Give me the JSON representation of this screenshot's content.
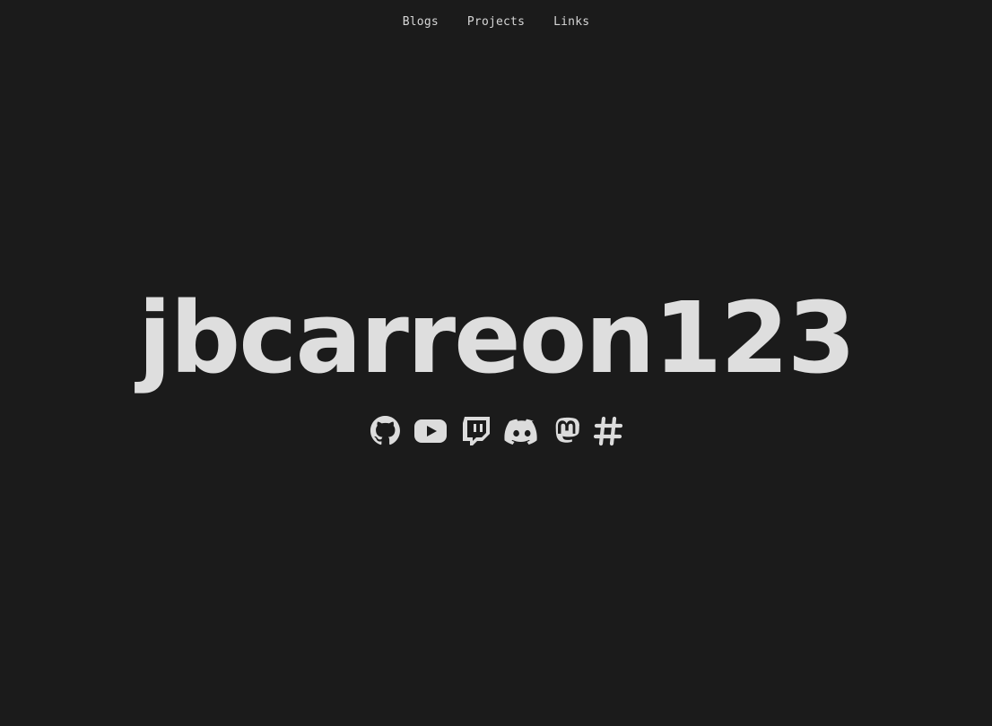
{
  "nav": {
    "items": [
      {
        "label": "Blogs"
      },
      {
        "label": "Projects"
      },
      {
        "label": "Links"
      }
    ]
  },
  "hero": {
    "title": "jbcarreon123"
  },
  "social": {
    "icons": [
      "github-icon",
      "youtube-icon",
      "twitch-icon",
      "discord-icon",
      "mastodon-icon",
      "hashtag-icon"
    ]
  },
  "colors": {
    "background": "#1b1b1b",
    "text": "#dedede"
  }
}
